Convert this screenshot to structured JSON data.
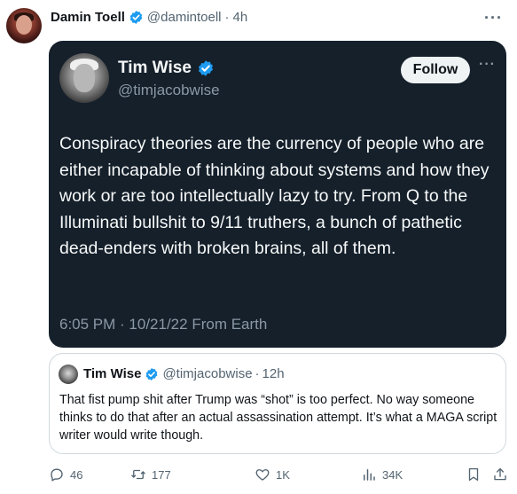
{
  "post": {
    "author_name": "Damin Toell",
    "author_handle": "@damintoell",
    "separator": "·",
    "time": "4h",
    "more_label": "···"
  },
  "screenshot": {
    "author_name": "Tim Wise",
    "author_handle": "@timjacobwise",
    "follow_label": "Follow",
    "more_label": "···",
    "text": "Conspiracy theories are the currency of people who are either incapable of thinking about systems and how they work or are too intellectually lazy to try. From Q to the Illuminati bullshit to 9/11 truthers, a bunch of pathetic dead-enders with broken brains, all of them.",
    "meta": "6:05 PM · 10/21/22 From Earth"
  },
  "quote": {
    "author_name": "Tim Wise",
    "author_handle": "@timjacobwise",
    "separator": "·",
    "time": "12h",
    "text": "That fist pump shit after Trump was “shot” is too perfect. No way someone thinks to do that after an actual assassination attempt. It’s what a MAGA script writer would write though."
  },
  "actions": {
    "replies": "46",
    "reposts": "177",
    "likes": "1K",
    "views": "34K"
  },
  "colors": {
    "verified": "#1d9bf0",
    "dark_bg": "#15202b",
    "muted": "#536471"
  }
}
